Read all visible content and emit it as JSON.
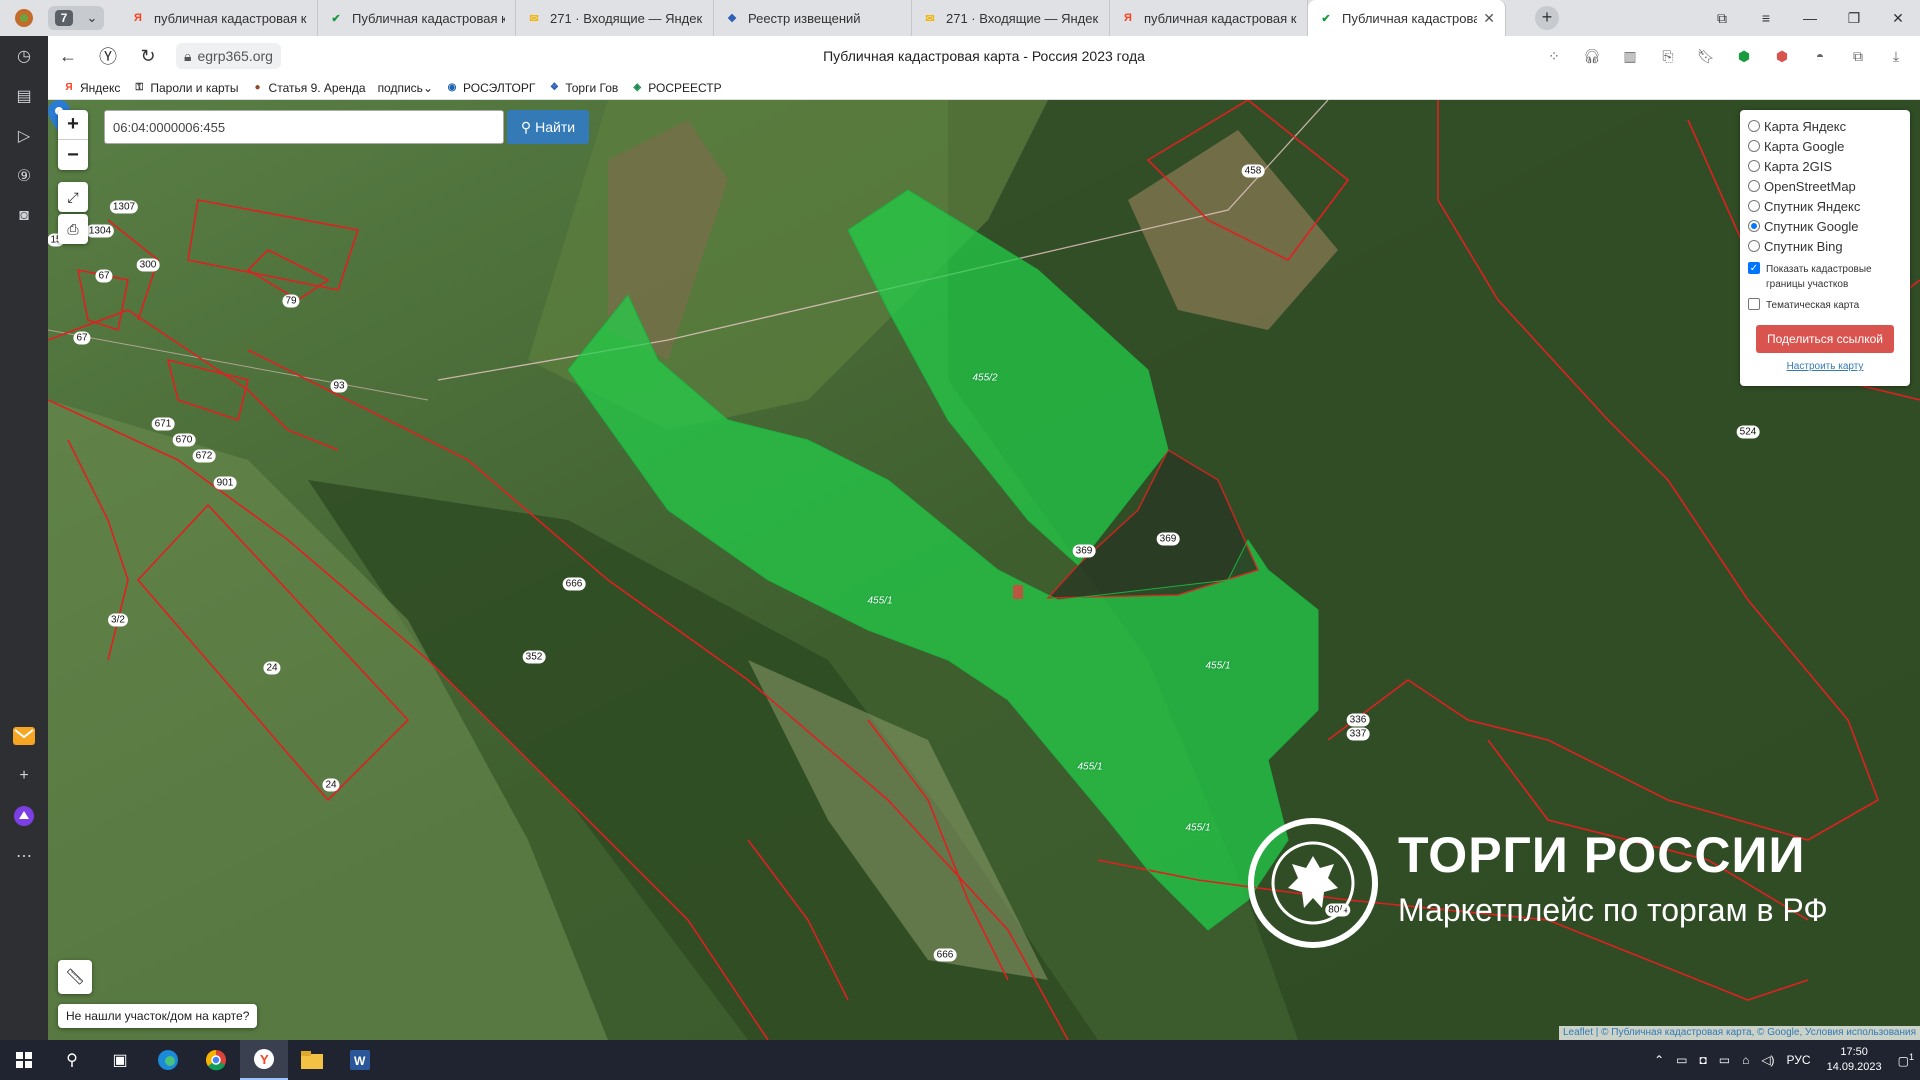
{
  "browser": {
    "tab_count": "7",
    "tabs": [
      {
        "title": "публичная кадастровая к",
        "icon": "yandex-icon",
        "color": "#fc3f1d"
      },
      {
        "title": "Публичная кадастровая к",
        "icon": "check-icon",
        "color": "#1a9c3e"
      },
      {
        "title": "271 · Входящие — Яндекс",
        "icon": "mail-icon",
        "color": "#f6b400"
      },
      {
        "title": "Реестр извещений",
        "icon": "emblem-icon",
        "color": "#2b5cb8"
      },
      {
        "title": "271 · Входящие — Яндекс",
        "icon": "mail-icon",
        "color": "#f6b400"
      },
      {
        "title": "публичная кадастровая к",
        "icon": "yandex-icon",
        "color": "#fc3f1d"
      },
      {
        "title": "Публичная кадастрова",
        "icon": "check-icon",
        "color": "#1a9c3e"
      }
    ],
    "url": "egrp365.org",
    "page_title": "Публичная кадастровая карта - Россия 2023 года",
    "bookmarks": [
      {
        "label": "Яндекс",
        "icon": "yandex-icon",
        "color": "#fc3f1d"
      },
      {
        "label": "Пароли и карты",
        "icon": "key-icon",
        "color": "#333333"
      },
      {
        "label": "Статья 9. Аренда",
        "icon": "article-icon",
        "color": "#8a4b2a"
      },
      {
        "label": "подпись",
        "icon": "",
        "color": ""
      },
      {
        "label": "РОСЭЛТОРГ",
        "icon": "roseltorg-icon",
        "color": "#1e63b0"
      },
      {
        "label": "Торги Гов",
        "icon": "emblem-icon",
        "color": "#2b5cb8"
      },
      {
        "label": "РОСРЕЕСТР",
        "icon": "rosreestr-icon",
        "color": "#1a8c4a"
      }
    ]
  },
  "map": {
    "search_value": "06:04:0000006:455",
    "find_label": "Найти",
    "layers": [
      {
        "label": "Карта Яндекс",
        "selected": false
      },
      {
        "label": "Карта Google",
        "selected": false
      },
      {
        "label": "Карта 2GIS",
        "selected": false
      },
      {
        "label": "OpenStreetMap",
        "selected": false
      },
      {
        "label": "Спутник Яндекс",
        "selected": false
      },
      {
        "label": "Спутник Google",
        "selected": true
      },
      {
        "label": "Спутник Bing",
        "selected": false
      }
    ],
    "show_borders_label": "Показать кадастровые границы участков",
    "show_borders": true,
    "thematic_label": "Тематическая карта",
    "thematic": false,
    "share_label": "Поделиться ссылкой",
    "configure_label": "Настроить карту",
    "hint_label": "Не нашли участок/дом на карте?",
    "attribution": "Leaflet | © Публичная кадастровая карта, © Google, Условия использования",
    "parcel_labels": [
      "458",
      "455/2",
      "369",
      "369",
      "455/1",
      "455/1",
      "455/1",
      "455/1",
      "336",
      "337",
      "524",
      "666",
      "666",
      "352",
      "24",
      "24",
      "79",
      "67",
      "93",
      "671",
      "670",
      "672",
      "901",
      "80/4",
      "1307",
      "1304",
      "300",
      "67",
      "3/2",
      "15"
    ],
    "highlight_color": "#21d04a",
    "border_color": "#e02020"
  },
  "watermark": {
    "title": "ТОРГИ РОССИИ",
    "subtitle": "Маркетплейс по торгам в РФ"
  },
  "taskbar": {
    "lang": "РУС",
    "time": "17:50",
    "date": "14.09.2023",
    "notif_count": "1"
  }
}
